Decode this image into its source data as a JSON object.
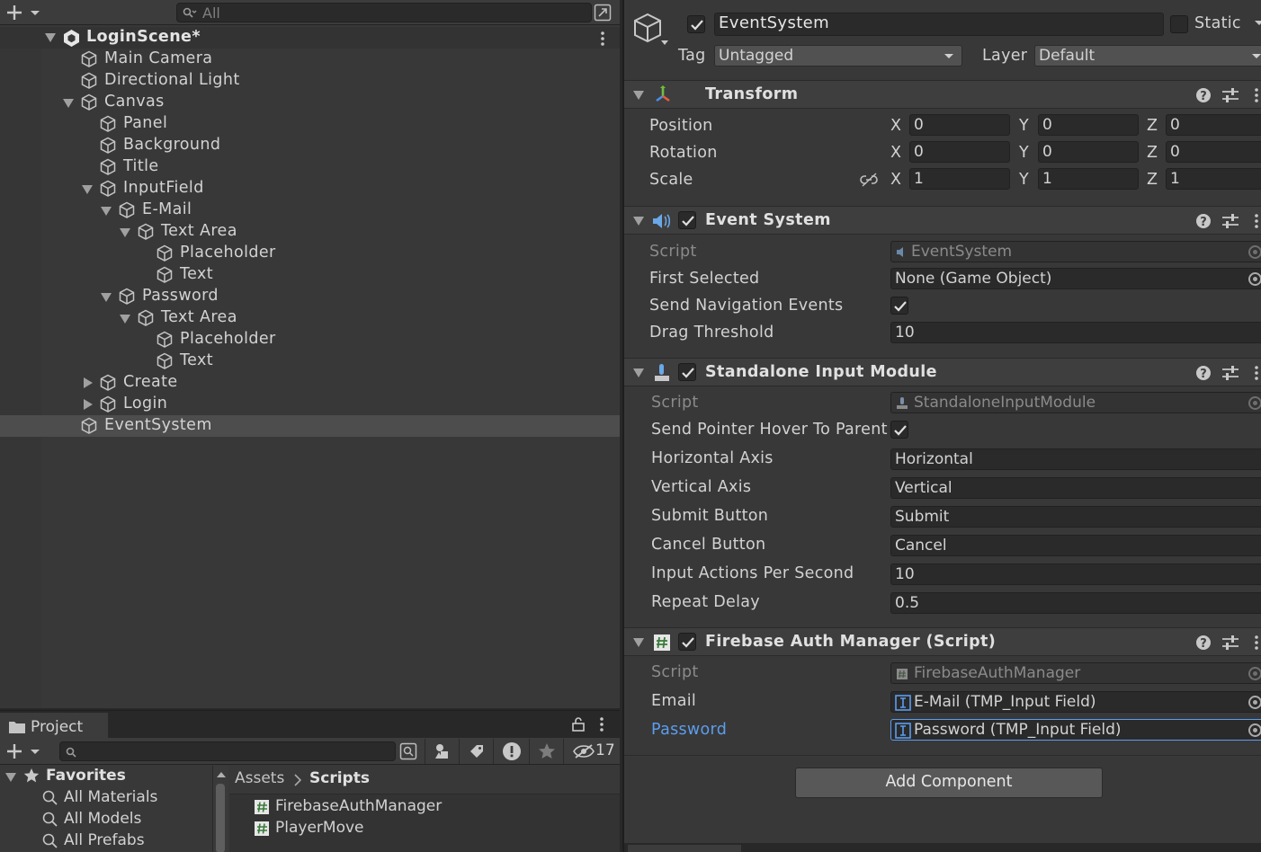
{
  "hierarchy": {
    "search_placeholder": "All",
    "scene_name": "LoginScene*",
    "items": [
      {
        "label": "Main Camera"
      },
      {
        "label": "Directional Light"
      },
      {
        "label": "Canvas"
      },
      {
        "label": "Panel"
      },
      {
        "label": "Background"
      },
      {
        "label": "Title"
      },
      {
        "label": "InputField"
      },
      {
        "label": "E-Mail"
      },
      {
        "label": "Text Area"
      },
      {
        "label": "Placeholder"
      },
      {
        "label": "Text"
      },
      {
        "label": "Password"
      },
      {
        "label": "Text Area"
      },
      {
        "label": "Placeholder"
      },
      {
        "label": "Text"
      },
      {
        "label": "Create"
      },
      {
        "label": "Login"
      },
      {
        "label": "EventSystem"
      }
    ]
  },
  "project": {
    "tab_label": "Project",
    "hidden_count": "17",
    "favorites_label": "Favorites",
    "favorites": [
      "All Materials",
      "All Models",
      "All Prefabs"
    ],
    "breadcrumb": {
      "root": "Assets",
      "current": "Scripts"
    },
    "files": [
      "FirebaseAuthManager",
      "PlayerMove"
    ]
  },
  "inspector": {
    "object_name": "EventSystem",
    "active": true,
    "static_label": "Static",
    "tag_label": "Tag",
    "tag_value": "Untagged",
    "layer_label": "Layer",
    "layer_value": "Default",
    "transform": {
      "title": "Transform",
      "position_label": "Position",
      "rotation_label": "Rotation",
      "scale_label": "Scale",
      "axes": {
        "x": "X",
        "y": "Y",
        "z": "Z"
      },
      "position": [
        "0",
        "0",
        "0"
      ],
      "rotation": [
        "0",
        "0",
        "0"
      ],
      "scale": [
        "1",
        "1",
        "1"
      ]
    },
    "event_system": {
      "title": "Event System",
      "script_label": "Script",
      "script_value": "EventSystem",
      "first_selected_label": "First Selected",
      "first_selected_value": "None (Game Object)",
      "send_nav_label": "Send Navigation Events",
      "send_nav_checked": true,
      "drag_threshold_label": "Drag Threshold",
      "drag_threshold_value": "10"
    },
    "standalone_input": {
      "title": "Standalone Input Module",
      "script_label": "Script",
      "script_value": "StandaloneInputModule",
      "hover_label": "Send Pointer Hover To Parent",
      "hover_checked": true,
      "horizontal_label": "Horizontal Axis",
      "horizontal_value": "Horizontal",
      "vertical_label": "Vertical Axis",
      "vertical_value": "Vertical",
      "submit_label": "Submit Button",
      "submit_value": "Submit",
      "cancel_label": "Cancel Button",
      "cancel_value": "Cancel",
      "ips_label": "Input Actions Per Second",
      "ips_value": "10",
      "repeat_label": "Repeat Delay",
      "repeat_value": "0.5"
    },
    "firebase": {
      "title": "Firebase Auth Manager (Script)",
      "script_label": "Script",
      "script_value": "FirebaseAuthManager",
      "email_label": "Email",
      "email_value": "E-Mail (TMP_Input Field)",
      "password_label": "Password",
      "password_value": "Password (TMP_Input Field)"
    },
    "add_component_label": "Add Component"
  },
  "colors": {
    "panel_bg": "#383838",
    "field_bg": "#2a2a2a",
    "selection": "#4d4d4d",
    "accent_blue": "#5c9ded",
    "text": "#d2d2d2"
  }
}
